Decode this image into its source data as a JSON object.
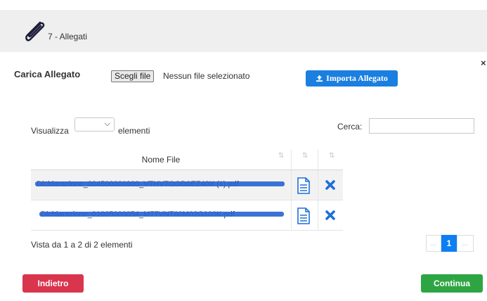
{
  "header": {
    "title": "7 - Allegati",
    "icon": "paperclip-icon"
  },
  "modal": {
    "close_label": "×"
  },
  "upload": {
    "label": "Carica Allegato",
    "choose_button": "Scegli file",
    "status": "Nessun file selezionato",
    "import_button": "Importa Allegato",
    "import_icon": "upload-icon"
  },
  "table_controls": {
    "show_label": "Visualizza",
    "length_value": "",
    "elements_label": "elementi",
    "search_label": "Cerca:",
    "search_value": ""
  },
  "table": {
    "columns": [
      {
        "label": "Nome File"
      },
      {
        "label": ""
      },
      {
        "label": ""
      }
    ],
    "rows": [
      {
        "name_visible": "Dichiarazione_004500001000_VTHVTOOD0EZ40X (1).pdf",
        "redacted": true
      },
      {
        "name_visible": "Dichiarazione_01005000054_M77VNT00M02G100K.pdf",
        "redacted": true
      }
    ]
  },
  "footer": {
    "info": "Vista da 1 a 2 di 2 elementi",
    "pagination": {
      "prev": "...",
      "current": "1",
      "next": "..."
    }
  },
  "actions": {
    "back": "Indietro",
    "continue": "Continua"
  },
  "colors": {
    "import_button": "#1a7fe0",
    "back_button": "#d9354d",
    "continue_button": "#2ea543",
    "action_icon": "#1d6fd8",
    "header_bg": "#efefef"
  }
}
